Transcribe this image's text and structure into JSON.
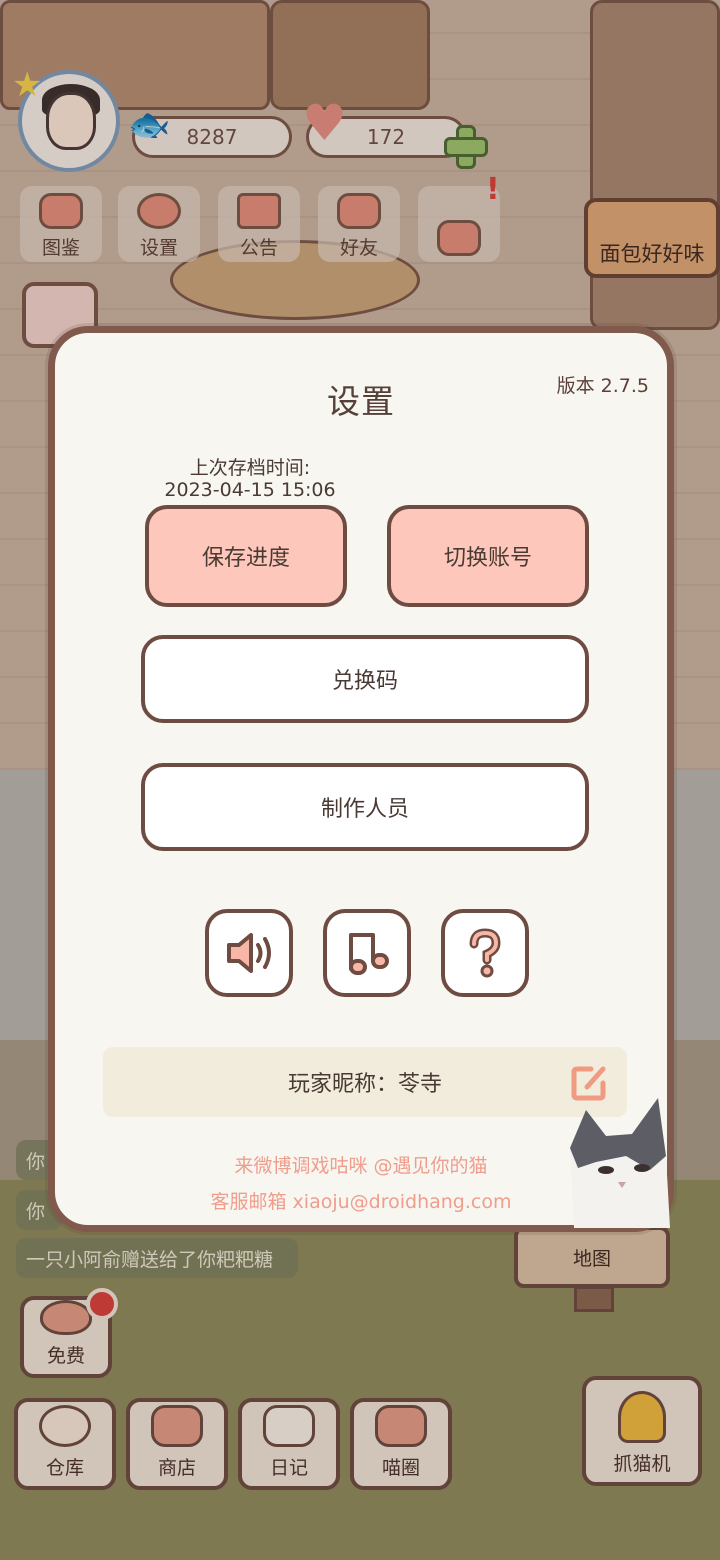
{
  "hud": {
    "coins": "8287",
    "hearts": "172",
    "buttons": [
      {
        "label": "图鉴",
        "icon": "book-icon"
      },
      {
        "label": "设置",
        "icon": "gear-icon"
      },
      {
        "label": "公告",
        "icon": "gift-icon"
      },
      {
        "label": "好友",
        "icon": "friends-icon"
      },
      {
        "label": "",
        "icon": "mail-icon"
      }
    ],
    "alert_mark": "!"
  },
  "scene": {
    "bread_sign": "面包好好味",
    "map_sign": "地图"
  },
  "chat": {
    "line1": "你",
    "line2": "你",
    "line3": "一只小阿俞赠送给了你粑粑糖"
  },
  "bottom": {
    "free": "免费",
    "warehouse": "仓库",
    "shop": "商店",
    "diary": "日记",
    "cat_circle": "喵圈",
    "claw_machine": "抓猫机"
  },
  "dialog": {
    "title": "设置",
    "version": "版本 2.7.5",
    "save_time_label": "上次存档时间:",
    "save_time_value": "2023-04-15 15:06",
    "save_button": "保存进度",
    "switch_button": "切换账号",
    "redeem_button": "兑换码",
    "credits_button": "制作人员",
    "nickname": "玩家昵称：苓寺",
    "promo_weibo": "来微博调戏咕咪 @遇见你的猫",
    "promo_email": "客服邮箱 xiaoju@droidhang.com"
  },
  "colors": {
    "dialog_border": "#7f5a4d",
    "pink_button": "#fdc8bb",
    "promo_text": "#ef9d8c",
    "plus_green": "#9dc46e"
  }
}
